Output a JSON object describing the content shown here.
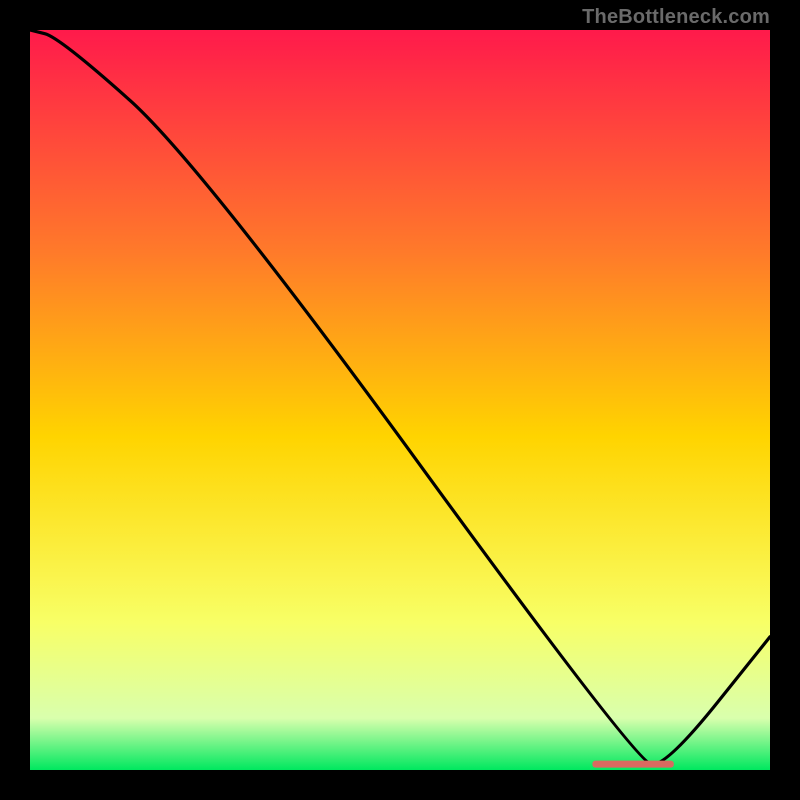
{
  "attribution": "TheBottleneck.com",
  "colors": {
    "gradient_top": "#ff1a4b",
    "gradient_mid_upper": "#ff7a2a",
    "gradient_mid": "#ffd400",
    "gradient_mid_lower": "#f8ff66",
    "gradient_lower": "#d9ffad",
    "gradient_bottom": "#00e85f",
    "line": "#000000",
    "marker": "#d86a60",
    "frame": "#000000",
    "attribution_text": "#6a6a6a"
  },
  "chart_data": {
    "type": "line",
    "title": "",
    "xlabel": "",
    "ylabel": "",
    "xlim": [
      0,
      100
    ],
    "ylim": [
      0,
      100
    ],
    "x": [
      0,
      4,
      23,
      82,
      86,
      100
    ],
    "values": [
      100,
      99,
      82,
      1,
      0.5,
      18
    ],
    "marker_segment": {
      "x_start": 76,
      "x_end": 87,
      "y": 0.8
    },
    "grid": false,
    "legend": false
  }
}
